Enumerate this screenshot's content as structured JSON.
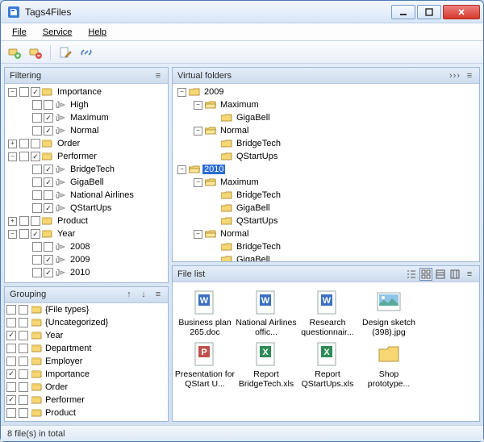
{
  "app": {
    "title": "Tags4Files"
  },
  "menu": {
    "file": "File",
    "service": "Service",
    "help": "Help"
  },
  "panels": {
    "filtering": "Filtering",
    "grouping": "Grouping",
    "virtual_folders": "Virtual folders",
    "file_list": "File list"
  },
  "filtering": {
    "items": [
      {
        "indent": 0,
        "exp": "-",
        "chk1": false,
        "chk2": true,
        "icon": "tag",
        "label": "Importance"
      },
      {
        "indent": 1,
        "exp": "",
        "chk1": false,
        "chk2": false,
        "icon": "clip",
        "label": "High"
      },
      {
        "indent": 1,
        "exp": "",
        "chk1": false,
        "chk2": true,
        "icon": "clip",
        "label": "Maximum"
      },
      {
        "indent": 1,
        "exp": "",
        "chk1": false,
        "chk2": true,
        "icon": "clip",
        "label": "Normal"
      },
      {
        "indent": 0,
        "exp": "+",
        "chk1": false,
        "chk2": false,
        "icon": "tag",
        "label": "Order"
      },
      {
        "indent": 0,
        "exp": "-",
        "chk1": false,
        "chk2": true,
        "icon": "tag",
        "label": "Performer"
      },
      {
        "indent": 1,
        "exp": "",
        "chk1": false,
        "chk2": true,
        "icon": "clip",
        "label": "BridgeTech"
      },
      {
        "indent": 1,
        "exp": "",
        "chk1": false,
        "chk2": true,
        "icon": "clip",
        "label": "GigaBell"
      },
      {
        "indent": 1,
        "exp": "",
        "chk1": false,
        "chk2": false,
        "icon": "clip",
        "label": "National Airlines"
      },
      {
        "indent": 1,
        "exp": "",
        "chk1": false,
        "chk2": true,
        "icon": "clip",
        "label": "QStartUps"
      },
      {
        "indent": 0,
        "exp": "+",
        "chk1": false,
        "chk2": false,
        "icon": "tag",
        "label": "Product"
      },
      {
        "indent": 0,
        "exp": "-",
        "chk1": false,
        "chk2": true,
        "icon": "tag",
        "label": "Year"
      },
      {
        "indent": 1,
        "exp": "",
        "chk1": false,
        "chk2": false,
        "icon": "clip",
        "label": "2008"
      },
      {
        "indent": 1,
        "exp": "",
        "chk1": false,
        "chk2": true,
        "icon": "clip",
        "label": "2009"
      },
      {
        "indent": 1,
        "exp": "",
        "chk1": false,
        "chk2": true,
        "icon": "clip",
        "label": "2010"
      }
    ]
  },
  "grouping": {
    "items": [
      {
        "c1": false,
        "c2": false,
        "label": "{File types}"
      },
      {
        "c1": false,
        "c2": false,
        "label": "{Uncategorized}"
      },
      {
        "c1": true,
        "c2": false,
        "label": "Year"
      },
      {
        "c1": false,
        "c2": false,
        "label": "Department"
      },
      {
        "c1": false,
        "c2": false,
        "label": "Employer"
      },
      {
        "c1": true,
        "c2": false,
        "label": "Importance"
      },
      {
        "c1": false,
        "c2": false,
        "label": "Order"
      },
      {
        "c1": true,
        "c2": false,
        "label": "Performer"
      },
      {
        "c1": false,
        "c2": false,
        "label": "Product"
      }
    ]
  },
  "vfolders": {
    "items": [
      {
        "indent": 0,
        "exp": "-",
        "open": false,
        "label": "2009",
        "sel": false
      },
      {
        "indent": 1,
        "exp": "-",
        "open": true,
        "label": "Maximum",
        "sel": false
      },
      {
        "indent": 2,
        "exp": "",
        "open": false,
        "label": "GigaBell",
        "sel": false
      },
      {
        "indent": 1,
        "exp": "-",
        "open": true,
        "label": "Normal",
        "sel": false
      },
      {
        "indent": 2,
        "exp": "",
        "open": false,
        "label": "BridgeTech",
        "sel": false
      },
      {
        "indent": 2,
        "exp": "",
        "open": false,
        "label": "QStartUps",
        "sel": false
      },
      {
        "indent": 0,
        "exp": "-",
        "open": true,
        "label": "2010",
        "sel": true
      },
      {
        "indent": 1,
        "exp": "-",
        "open": true,
        "label": "Maximum",
        "sel": false
      },
      {
        "indent": 2,
        "exp": "",
        "open": false,
        "label": "BridgeTech",
        "sel": false
      },
      {
        "indent": 2,
        "exp": "",
        "open": false,
        "label": "GigaBell",
        "sel": false
      },
      {
        "indent": 2,
        "exp": "",
        "open": false,
        "label": "QStartUps",
        "sel": false
      },
      {
        "indent": 1,
        "exp": "-",
        "open": true,
        "label": "Normal",
        "sel": false
      },
      {
        "indent": 2,
        "exp": "",
        "open": false,
        "label": "BridgeTech",
        "sel": false
      },
      {
        "indent": 2,
        "exp": "",
        "open": false,
        "label": "GigaBell",
        "sel": false
      }
    ]
  },
  "files": {
    "items": [
      {
        "type": "doc",
        "label": "Business plan 265.doc"
      },
      {
        "type": "doc",
        "label": "National Airlines offic..."
      },
      {
        "type": "doc",
        "label": "Research questionnair..."
      },
      {
        "type": "img",
        "label": "Design sketch (398).jpg"
      },
      {
        "type": "ppt",
        "label": "Presentation for QStart U..."
      },
      {
        "type": "xls",
        "label": "Report BridgeTech.xls"
      },
      {
        "type": "xls",
        "label": "Report QStartUps.xls"
      },
      {
        "type": "folder",
        "label": "Shop prototype..."
      }
    ]
  },
  "status": {
    "text": "8 file(s) in total"
  }
}
